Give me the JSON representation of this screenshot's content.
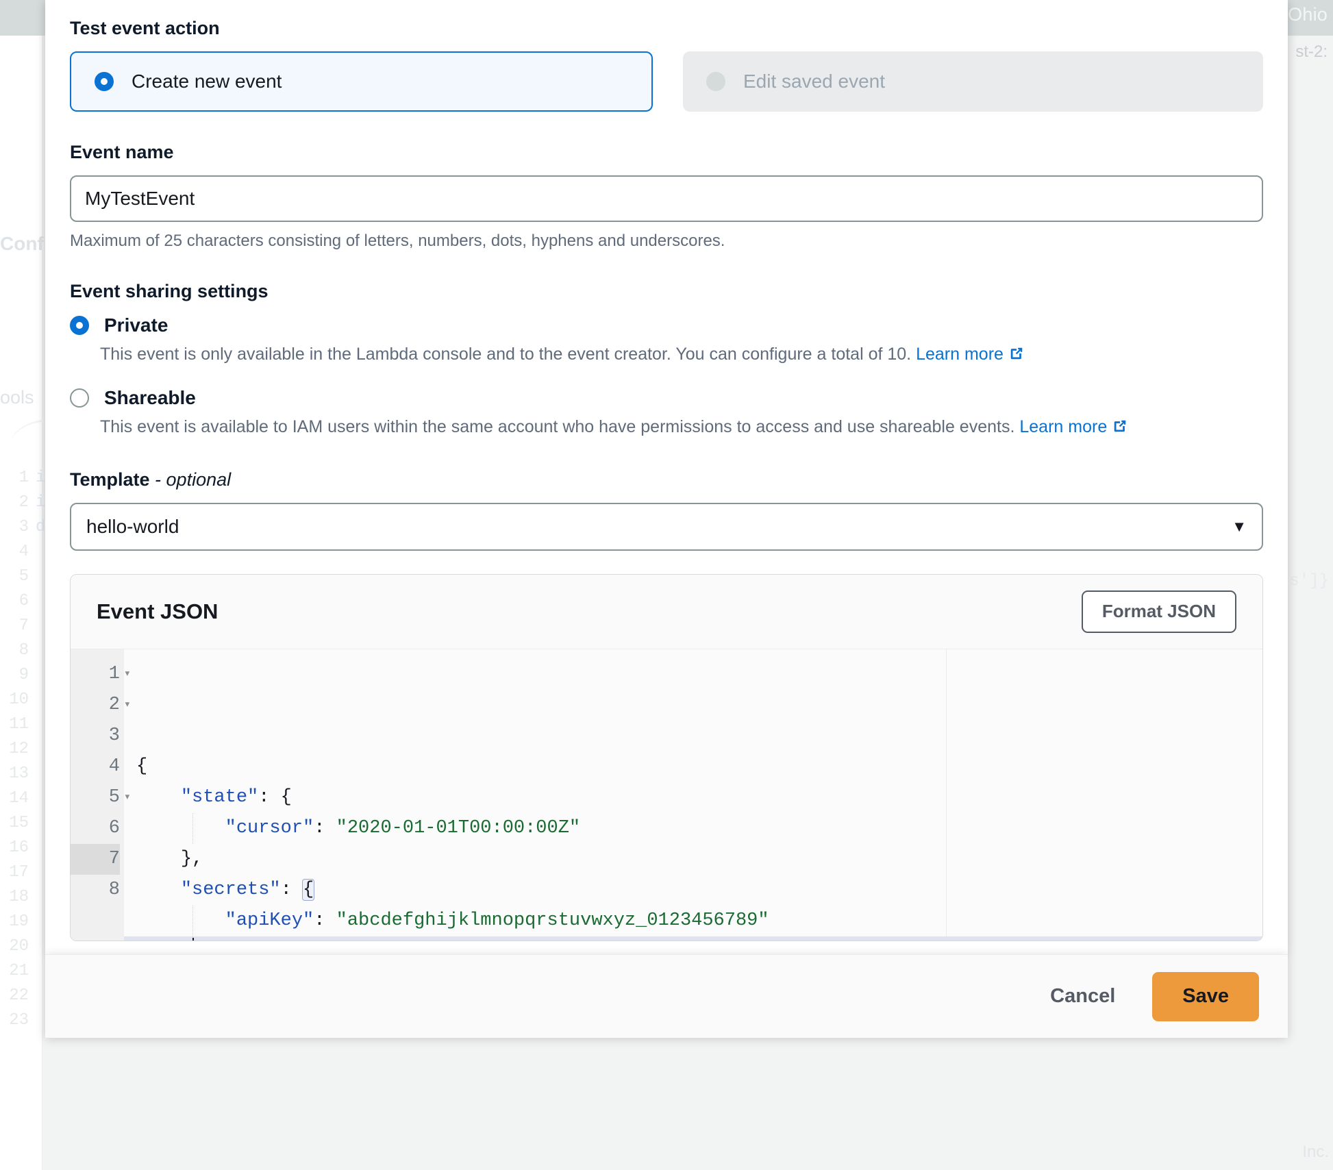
{
  "background": {
    "region_label": "Ohio",
    "breadcrumb_fragment": "st-2:",
    "label_config": "Confi",
    "label_pools": "ools",
    "right_code_fragment": "s']}",
    "right_inc_fragment": "Inc.",
    "gutter_lines": [
      "1",
      "2",
      "3",
      "4",
      "5",
      "6",
      "7",
      "8",
      "9",
      "10",
      "11",
      "12",
      "13",
      "14",
      "15",
      "16",
      "17",
      "18",
      "19",
      "20",
      "21",
      "22",
      "23"
    ],
    "code_fragments": [
      "i",
      "i",
      "",
      "d"
    ]
  },
  "dialog": {
    "test_event_action": {
      "label": "Test event action",
      "options": [
        {
          "label": "Create new event",
          "selected": true,
          "disabled": false
        },
        {
          "label": "Edit saved event",
          "selected": false,
          "disabled": true
        }
      ]
    },
    "event_name": {
      "label": "Event name",
      "value": "MyTestEvent",
      "placeholder": "",
      "hint": "Maximum of 25 characters consisting of letters, numbers, dots, hyphens and underscores."
    },
    "event_sharing": {
      "label": "Event sharing settings",
      "options": [
        {
          "title": "Private",
          "selected": true,
          "description": "This event is only available in the Lambda console and to the event creator. You can configure a total of 10.",
          "link_text": "Learn more"
        },
        {
          "title": "Shareable",
          "selected": false,
          "description": "This event is available to IAM users within the same account who have permissions to access and use shareable events.",
          "link_text": "Learn more"
        }
      ]
    },
    "template": {
      "label_main": "Template",
      "label_optional": "- optional",
      "value": "hello-world",
      "caret_icon": "chevron-down-icon"
    },
    "editor": {
      "title": "Event JSON",
      "format_button": "Format JSON",
      "active_line": 7,
      "lines": [
        {
          "n": "1",
          "foldable": true,
          "text": "{"
        },
        {
          "n": "2",
          "foldable": true,
          "text": "    \"state\": {"
        },
        {
          "n": "3",
          "foldable": false,
          "text": "        \"cursor\": \"2020-01-01T00:00:00Z\""
        },
        {
          "n": "4",
          "foldable": false,
          "text": "    },"
        },
        {
          "n": "5",
          "foldable": true,
          "text": "    \"secrets\": {"
        },
        {
          "n": "6",
          "foldable": false,
          "text": "        \"apiKey\": \"abcdefghijklmnopqrstuvwxyz_0123456789\""
        },
        {
          "n": "7",
          "foldable": false,
          "text": "    }"
        },
        {
          "n": "8",
          "foldable": false,
          "text": "}"
        }
      ],
      "json_value": {
        "state": {
          "cursor": "2020-01-01T00:00:00Z"
        },
        "secrets": {
          "apiKey": "abcdefghijklmnopqrstuvwxyz_0123456789"
        }
      }
    },
    "footer": {
      "cancel_label": "Cancel",
      "save_label": "Save"
    }
  },
  "colors": {
    "accent_blue": "#0972d3",
    "save_orange": "#ec9a3c",
    "json_key": "#1e4fb5",
    "json_string": "#1a6b32",
    "muted_text": "#5f6b7a"
  }
}
